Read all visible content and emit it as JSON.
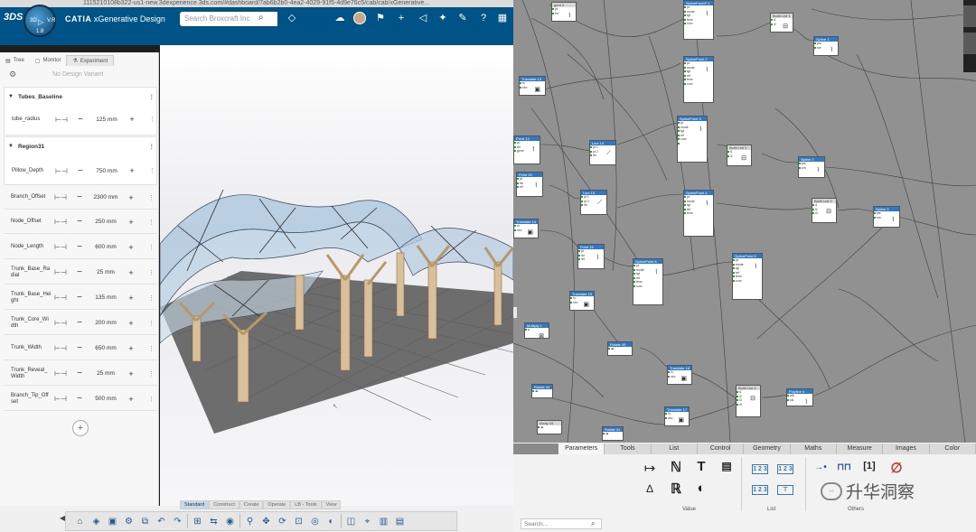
{
  "browser": {
    "url": "1115210108b322-us1-new.3dexperience.3ds.com/#dashboard/7ab6b2b0-4ea2-4029-91f5-4d9e76c5/cab/cab/xGenerative..."
  },
  "header": {
    "brand": "3DS",
    "app_name_prefix": "CATIA",
    "app_name": "xGenerative Design",
    "search_placeholder": "Search Broxcraft Inc",
    "compass": {
      "left": "3D",
      "right": "V.R",
      "bottom": "1.8"
    },
    "icons": [
      "tag-icon",
      "cloud-icon",
      "avatar",
      "plus-icon",
      "share-icon",
      "collaborate-icon",
      "help-icon",
      "grid-icon"
    ],
    "brand_color": "#005386"
  },
  "left_panel": {
    "tabs": [
      {
        "label": "Tree",
        "active": false
      },
      {
        "label": "Monitor",
        "active": false
      },
      {
        "label": "Experiment",
        "active": true
      }
    ],
    "variant_text": "No Design Variant",
    "groups": [
      {
        "title": "Tubes_Baseline",
        "params": [
          {
            "label": "tube_radius",
            "value": "125 mm"
          }
        ]
      },
      {
        "title": "Region31",
        "params": [
          {
            "label": "Pillow_Depth",
            "value": "750 mm"
          }
        ]
      }
    ],
    "params": [
      {
        "label": "Branch_Offset",
        "value": "2300 mm"
      },
      {
        "label": "Node_Offset",
        "value": "250 mm"
      },
      {
        "label": "Node_Length",
        "value": "600 mm"
      },
      {
        "label": "Trunk_Base_Ra dial",
        "value": "25 mm"
      },
      {
        "label": "Trunk_Base_Hei ght",
        "value": "135 mm"
      },
      {
        "label": "Trunk_Core_Wi dth",
        "value": "200 mm"
      },
      {
        "label": "Trunk_Width",
        "value": "650 mm"
      },
      {
        "label": "Trunk_Reveal_ Width",
        "value": "25 mm"
      },
      {
        "label": "Branch_Tip_Off set",
        "value": "500 mm"
      }
    ],
    "add_label": "+"
  },
  "action_bar": {
    "tabs": [
      {
        "label": "Standard",
        "active": true
      },
      {
        "label": "Construct",
        "active": false
      },
      {
        "label": "Create",
        "active": false
      },
      {
        "label": "Operate",
        "active": false
      },
      {
        "label": "LB - Tools",
        "active": false
      },
      {
        "label": "View",
        "active": false
      }
    ]
  },
  "graph": {
    "nodes": [
      {
        "id": "n1",
        "title": "gent 2",
        "ports": [
          "pt",
          "fnt",
          "sid"
        ],
        "header": "grey"
      },
      {
        "id": "n2",
        "title": "Translate 13",
        "ports": [
          "in",
          "vec",
          "dist"
        ]
      },
      {
        "id": "n3",
        "title": "Point 14",
        "ports": [
          "pt",
          "dir",
          "gene",
          "dist"
        ]
      },
      {
        "id": "n4",
        "title": "Point 15",
        "ports": [
          "pt",
          "dir",
          "ref"
        ]
      },
      {
        "id": "n5",
        "title": "Translate 14",
        "ports": [
          "in",
          "vec"
        ]
      },
      {
        "id": "n6",
        "title": "Line 14",
        "ports": [
          "pt 1",
          "pt 2",
          "dir"
        ]
      },
      {
        "id": "n7",
        "title": "Line 15",
        "ports": [
          "pt 1",
          "pt 2",
          "dir"
        ]
      },
      {
        "id": "n8",
        "title": "Point 16",
        "ports": [
          "pt",
          "dir",
          "ref"
        ]
      },
      {
        "id": "n9",
        "title": "Translate 15",
        "ports": [
          "in",
          "vec"
        ]
      },
      {
        "id": "n10",
        "title": "Multiply 1",
        "ports": [
          "a",
          "b"
        ]
      },
      {
        "id": "n11",
        "title": "SplineFromP 2",
        "ports": [
          "pt",
          "mode",
          "tgt",
          "tens",
          "curv",
          "crv"
        ]
      },
      {
        "id": "n12",
        "title": "SplinePoint 2",
        "ports": [
          "pt",
          "mode",
          "tgt",
          "ref",
          "tens",
          "curv"
        ]
      },
      {
        "id": "n13",
        "title": "SplinePoint 3",
        "ports": [
          "pt",
          "mode",
          "tgt",
          "ref",
          "curv"
        ]
      },
      {
        "id": "n14",
        "title": "SplinePoint 4",
        "ports": [
          "pt",
          "mode",
          "tgt",
          "ref",
          "tens",
          "curv"
        ]
      },
      {
        "id": "n15",
        "title": "SplinePoint 5",
        "ports": [
          "pt",
          "mode",
          "tgt",
          "ref",
          "tens",
          "curv"
        ]
      },
      {
        "id": "n16",
        "title": "SplinePoint 6",
        "ports": [
          "pt",
          "mode",
          "tgt",
          "ref",
          "tens",
          "curv"
        ]
      },
      {
        "id": "n17",
        "title": "Build List 1",
        "ports": [
          "i1",
          "i2"
        ],
        "header": "grey"
      },
      {
        "id": "n18",
        "title": "Spline 1",
        "ports": [
          "pts",
          "sm",
          "cyc"
        ]
      },
      {
        "id": "n19",
        "title": "Build List 2",
        "ports": [
          "i1",
          "i2"
        ],
        "header": "grey"
      },
      {
        "id": "n20",
        "title": "Spline 2",
        "ports": [
          "pts",
          "sm",
          "cyc"
        ]
      },
      {
        "id": "n21",
        "title": "Build List 3",
        "ports": [
          "i1",
          "i2",
          "i3"
        ],
        "header": "grey"
      },
      {
        "id": "n22",
        "title": "Spline 3",
        "ports": [
          "pts",
          "sm",
          "cyc"
        ]
      },
      {
        "id": "n23",
        "title": "Rotate 40",
        "ports": [
          "in"
        ]
      },
      {
        "id": "n24",
        "title": "Translate 16",
        "ports": [
          "in",
          "vec"
        ]
      },
      {
        "id": "n25",
        "title": "Rotate 44",
        "ports": [
          "in"
        ]
      },
      {
        "id": "n26",
        "title": "Array 43",
        "ports": [
          "in"
        ],
        "header": "grey"
      },
      {
        "id": "n27",
        "title": "Rotate 41",
        "ports": [
          "in"
        ]
      },
      {
        "id": "n28",
        "title": "Translate 17",
        "ports": [
          "in",
          "vec"
        ]
      },
      {
        "id": "n29",
        "title": "Build List 4",
        "ports": [
          "i1",
          "i2",
          "i3",
          "i4"
        ],
        "header": "grey"
      },
      {
        "id": "n30",
        "title": "Polyline 4",
        "ports": [
          "pts",
          "cls"
        ]
      }
    ]
  },
  "toolbox": {
    "tabs": [
      {
        "label": "Parameters",
        "active": true
      },
      {
        "label": "Tools",
        "active": false
      },
      {
        "label": "List",
        "active": false
      },
      {
        "label": "Control",
        "active": false
      },
      {
        "label": "Geometry",
        "active": false
      },
      {
        "label": "Maths",
        "active": false
      },
      {
        "label": "Measure",
        "active": false
      },
      {
        "label": "Images",
        "active": false
      },
      {
        "label": "Color",
        "active": false
      }
    ],
    "groups": [
      {
        "label": "Value"
      },
      {
        "label": "List"
      },
      {
        "label": "Others"
      }
    ],
    "value_tools": [
      "↦",
      "ℕ",
      "T",
      "▤",
      "∆",
      "ℝ",
      "◐"
    ],
    "list_tools": [
      "1 2 3",
      "1 2 3",
      "1 2 3",
      "⊤"
    ],
    "others_tools": [
      "→•",
      "⊓⊓",
      "[1]",
      "∅"
    ],
    "search_placeholder": "Search...",
    "watermark": "升华洞察"
  }
}
